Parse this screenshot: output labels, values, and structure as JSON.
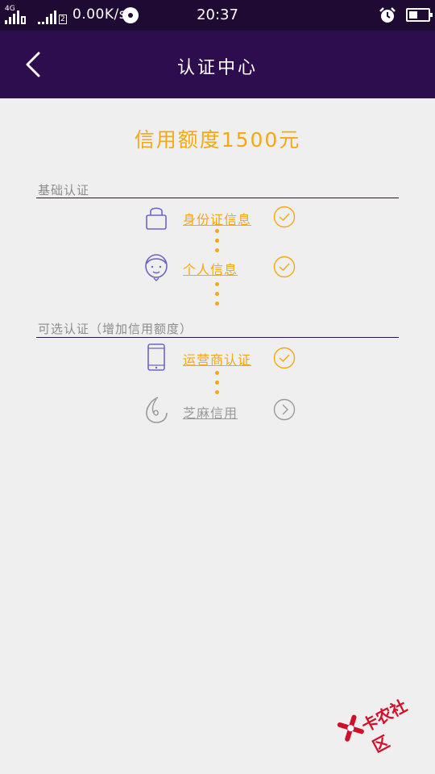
{
  "status_bar": {
    "network_type": "4G",
    "sim_slot": "2",
    "speed": "0.00K/s",
    "time": "20:37"
  },
  "header": {
    "title": "认证中心"
  },
  "credit": {
    "text": "信用额度1500元"
  },
  "sections": {
    "basic": {
      "title": "基础认证",
      "items": [
        {
          "label": "身份证信息",
          "icon": "lock-icon",
          "status": "check-icon"
        },
        {
          "label": "个人信息",
          "icon": "person-icon",
          "status": "check-icon"
        }
      ]
    },
    "optional": {
      "title": "可选认证（增加信用额度）",
      "items": [
        {
          "label": "运营商认证",
          "icon": "phone-icon",
          "status": "check-icon"
        },
        {
          "label": "芝麻信用",
          "icon": "sesame-icon",
          "status": "chevron-right-icon"
        }
      ]
    }
  },
  "watermark": {
    "text": "卡农社区"
  },
  "colors": {
    "status_bar_bg": "#1f0a33",
    "header_bg": "#2d0d4e",
    "accent": "#f6a714",
    "icon_purple": "#6f64c4",
    "inactive_gray": "#999999"
  }
}
